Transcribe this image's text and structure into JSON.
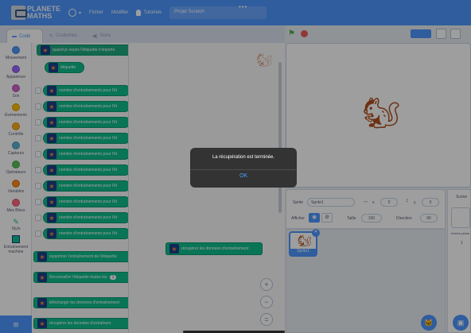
{
  "header": {
    "logo_line1": "PLANETE",
    "logo_line2": "MATHS",
    "menu_file": "Fichier",
    "menu_edit": "Modifier",
    "menu_tutorials": "Tutoriels",
    "project_title": "Projet Scratch",
    "more_dots": "•••"
  },
  "tabs": {
    "code": "Code",
    "costumes": "Costumes",
    "sounds": "Sons"
  },
  "categories": [
    {
      "label": "Mouvement",
      "color": "#4c97ff"
    },
    {
      "label": "Apparence",
      "color": "#9966ff"
    },
    {
      "label": "Son",
      "color": "#cf63cf"
    },
    {
      "label": "Événements",
      "color": "#ffbf00"
    },
    {
      "label": "Contrôle",
      "color": "#ffab19"
    },
    {
      "label": "Capteurs",
      "color": "#5cb1d6"
    },
    {
      "label": "Opérateurs",
      "color": "#59c059"
    },
    {
      "label": "Variables",
      "color": "#ff8c1a"
    },
    {
      "label": "Mes Blocs",
      "color": "#ff6680"
    },
    {
      "label": "Stylo",
      "color": "#0fbd8c"
    },
    {
      "label": "Entraînement machine",
      "color": "#0fbd8c"
    }
  ],
  "palette": {
    "hat_block": "quand je reçois l'étiquette  n'importe",
    "label_block": "étiquette",
    "count_block": "nombre d'entraînements pour l'ét",
    "clear_block": "supprimer l'entraînement de l'étiquette",
    "recognize_block": "Reconnaître l'étiquette toutes les",
    "recognize_value": "1",
    "download_block": "télécharger les données d'entraînement",
    "recover_block": "récupérer les données d'entraînem"
  },
  "workspace": {
    "block": "récupérer les données d'entraînement",
    "zoom_in": "+",
    "zoom_out": "−",
    "zoom_reset": "="
  },
  "sprite_info": {
    "sprite_label": "Sprite",
    "sprite_name": "Sprite1",
    "x_label": "x",
    "x_value": "0",
    "y_label": "y",
    "y_value": "0",
    "show_label": "Afficher",
    "size_label": "Taille",
    "size_value": "100",
    "direction_label": "Direction",
    "direction_value": "90"
  },
  "sprite_thumb": "Sprite1",
  "scene": {
    "title": "Scène",
    "backdrops": "Arrière-plans",
    "count": "1"
  },
  "dialog": {
    "message": "La récupération est terminée.",
    "ok": "OK"
  }
}
